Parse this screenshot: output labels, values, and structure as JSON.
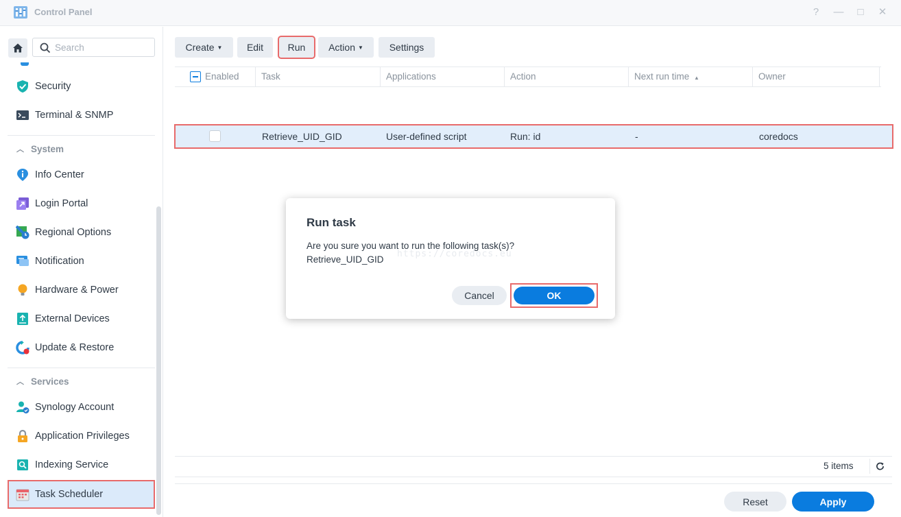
{
  "window": {
    "title": "Control Panel",
    "controls": [
      "?",
      "—",
      "□",
      "✕"
    ]
  },
  "sidebar": {
    "search_placeholder": "Search",
    "items_top": [
      {
        "label": "Security",
        "icon": "shield-icon"
      },
      {
        "label": "Terminal & SNMP",
        "icon": "terminal-icon"
      }
    ],
    "system": {
      "heading": "System",
      "items": [
        {
          "label": "Info Center",
          "icon": "info-icon"
        },
        {
          "label": "Login Portal",
          "icon": "login-portal-icon"
        },
        {
          "label": "Regional Options",
          "icon": "globe-clock-icon"
        },
        {
          "label": "Notification",
          "icon": "notification-icon"
        },
        {
          "label": "Hardware & Power",
          "icon": "bulb-icon"
        },
        {
          "label": "External Devices",
          "icon": "external-device-icon"
        },
        {
          "label": "Update & Restore",
          "icon": "update-icon"
        }
      ]
    },
    "services": {
      "heading": "Services",
      "items": [
        {
          "label": "Synology Account",
          "icon": "account-icon"
        },
        {
          "label": "Application Privileges",
          "icon": "lock-icon"
        },
        {
          "label": "Indexing Service",
          "icon": "indexing-icon"
        },
        {
          "label": "Task Scheduler",
          "icon": "calendar-icon"
        }
      ]
    }
  },
  "toolbar": {
    "create": "Create",
    "edit": "Edit",
    "run": "Run",
    "action": "Action",
    "settings": "Settings"
  },
  "grid": {
    "columns": [
      "Enabled",
      "Task",
      "Applications",
      "Action",
      "Next run time",
      "Owner"
    ],
    "rows": [
      {
        "enabled": false,
        "task": "Retrieve_UID_GID",
        "applications": "User-defined script",
        "action": "Run: id",
        "next_run_time": "-",
        "owner": "coredocs"
      }
    ],
    "item_count": "5 items"
  },
  "footer": {
    "reset": "Reset",
    "apply": "Apply"
  },
  "dialog": {
    "title": "Run task",
    "message": "Are you sure you want to run the following task(s)?",
    "task_name": "Retrieve_UID_GID",
    "watermark": "https://coredocs.eu",
    "cancel": "Cancel",
    "ok": "OK"
  },
  "colors": {
    "accent": "#0a7cdf",
    "highlight_outline": "#e86a6a",
    "selected_row": "#e2eefb"
  }
}
